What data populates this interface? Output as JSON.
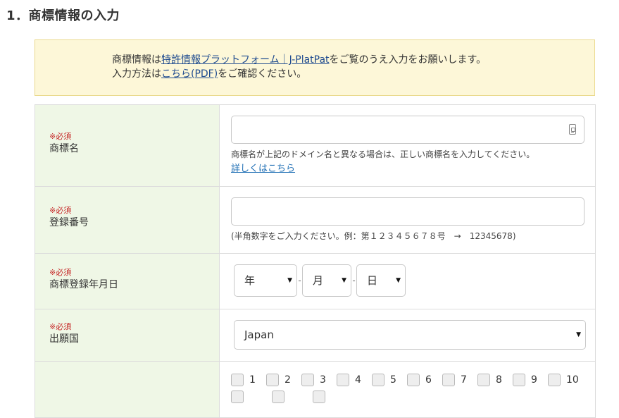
{
  "section": {
    "title": "1．商標情報の入力"
  },
  "notice": {
    "line1_pre": "商標情報は",
    "line1_link": "特許情報プラットフォーム｜J-PlatPat",
    "line1_post": "をご覧のうえ入力をお願いします。",
    "line2_pre": "入力方法は",
    "line2_link": "こちら(PDF)",
    "line2_post": "をご確認ください。"
  },
  "form": {
    "required_label": "※必須",
    "trademark_name": {
      "label": "商標名",
      "value": "",
      "placeholder": "",
      "help": "商標名が上記のドメイン名と異なる場合は、正しい商標名を入力してください。",
      "help_link": "詳しくはこちら"
    },
    "registration_number": {
      "label": "登録番号",
      "value": "",
      "placeholder": "",
      "help": "(半角数字をご入力ください。例：第１２３４５６７８号　→　12345678)"
    },
    "registration_date": {
      "label": "商標登録年月日",
      "year": "年",
      "month": "月",
      "day": "日",
      "separator": "-"
    },
    "country": {
      "label": "出願国",
      "selected": "Japan"
    },
    "classes": [
      "1",
      "2",
      "3",
      "4",
      "5",
      "6",
      "7",
      "8",
      "9",
      "10"
    ]
  },
  "colors": {
    "label_bg": "#eff7e6",
    "notice_bg": "#fdf7d8",
    "required": "#c62828",
    "link": "#1f6fb5"
  },
  "icons": {
    "input_adornment": "lock-icon",
    "select_arrow": "triangle-down-icon"
  }
}
